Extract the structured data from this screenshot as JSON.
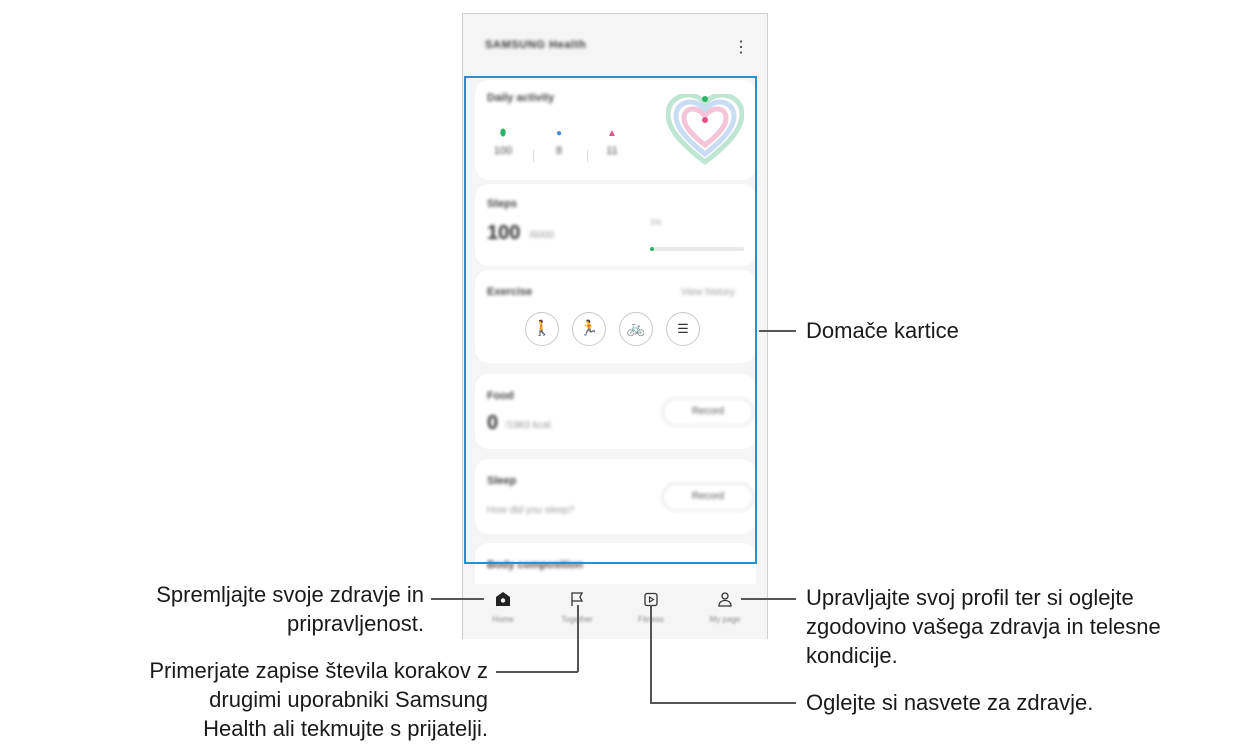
{
  "app": {
    "title": "SAMSUNG Health",
    "more_icon": "⋮"
  },
  "daily_activity": {
    "label": "Daily activity",
    "steps_value": "100",
    "minutes_value": "8",
    "calories_value": "11"
  },
  "steps": {
    "label": "Steps",
    "value": "100",
    "goal": "/6000",
    "percent_text": "1%",
    "progress_fraction": 0.02
  },
  "exercise": {
    "label": "Exercise",
    "link": "View history",
    "icons": [
      "walk-icon",
      "run-icon",
      "bike-icon",
      "list-icon"
    ]
  },
  "food": {
    "label": "Food",
    "value": "0",
    "goal": "/1983 kcal",
    "button": "Record"
  },
  "sleep": {
    "label": "Sleep",
    "question": "How did you sleep?",
    "button": "Record"
  },
  "body_composition": {
    "label": "Body composition"
  },
  "nav": {
    "home": "Home",
    "together": "Together",
    "fitness": "Fitness",
    "my_page": "My page"
  },
  "callouts": {
    "home_cards": "Domače kartice",
    "home_tab": [
      "Spremljajte svoje zdravje in",
      "pripravljenost."
    ],
    "together_tab": [
      "Primerjate zapise števila korakov z",
      "drugimi uporabniki Samsung",
      "Health ali tekmujte s prijatelji."
    ],
    "my_page_tab": [
      "Upravljajte svoj profil ter si oglejte",
      "zgodovino vašega zdravja in telesne",
      "kondicije."
    ],
    "fitness_tab": "Oglejte si nasvete za zdravje."
  },
  "colors": {
    "highlight": "#2b8fce",
    "steps_green": "#2fb36b",
    "active_blue": "#3d8fe0",
    "calorie_pink": "#e84e8a"
  }
}
